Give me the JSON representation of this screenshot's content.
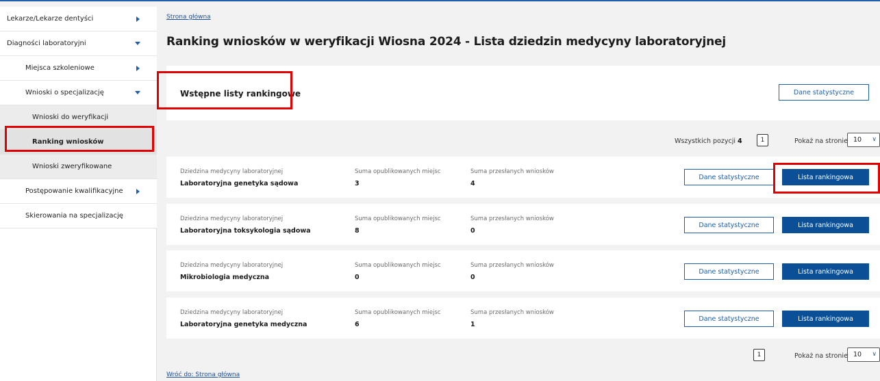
{
  "sidebar": {
    "items": [
      {
        "label": "Lekarze/Lekarze dentyści"
      },
      {
        "label": "Diagności laboratoryjni"
      },
      {
        "label": "Miejsca szkoleniowe"
      },
      {
        "label": "Wnioski o specjalizację"
      },
      {
        "label": "Wnioski do weryfikacji"
      },
      {
        "label": "Ranking wniosków"
      },
      {
        "label": "Wnioski zweryfikowane"
      },
      {
        "label": "Postępowanie kwalifikacyjne"
      },
      {
        "label": "Skierowania na specjalizację"
      }
    ]
  },
  "breadcrumb": "Strona główna",
  "page_title": "Ranking wniosków w weryfikacji Wiosna 2024 - Lista dziedzin medycyny laboratoryjnej",
  "section": {
    "title": "Wstępne listy rankingowe",
    "stats_button": "Dane statystyczne"
  },
  "pager_top": {
    "total_label": "Wszystkich pozycji",
    "total_value": "4",
    "page": "1",
    "per_page_label": "Pokaż na stronie",
    "per_page_value": "10"
  },
  "columns": {
    "field": "Dziedzina medycyny laboratoryjnej",
    "places": "Suma opublikowanych miejsc",
    "applications": "Suma przesłanych wniosków"
  },
  "rows": [
    {
      "field": "Laboratoryjna genetyka sądowa",
      "places": "3",
      "applications": "4",
      "stats": "Dane statystyczne",
      "ranking": "Lista rankingowa"
    },
    {
      "field": "Laboratoryjna toksykologia sądowa",
      "places": "8",
      "applications": "0",
      "stats": "Dane statystyczne",
      "ranking": "Lista rankingowa"
    },
    {
      "field": "Mikrobiologia medyczna",
      "places": "0",
      "applications": "0",
      "stats": "Dane statystyczne",
      "ranking": "Lista rankingowa"
    },
    {
      "field": "Laboratoryjna genetyka medyczna",
      "places": "6",
      "applications": "1",
      "stats": "Dane statystyczne",
      "ranking": "Lista rankingowa"
    }
  ],
  "pager_bottom": {
    "page": "1",
    "per_page_label": "Pokaż na stronie",
    "per_page_value": "10"
  },
  "back_link": "Wróć do: Strona główna",
  "colors": {
    "primary": "#0b4f96",
    "highlight": "#e00000"
  },
  "icons": {
    "collapsed": "chevron-right-icon",
    "expanded": "chevron-down-icon",
    "select": "chevron-down-icon"
  }
}
